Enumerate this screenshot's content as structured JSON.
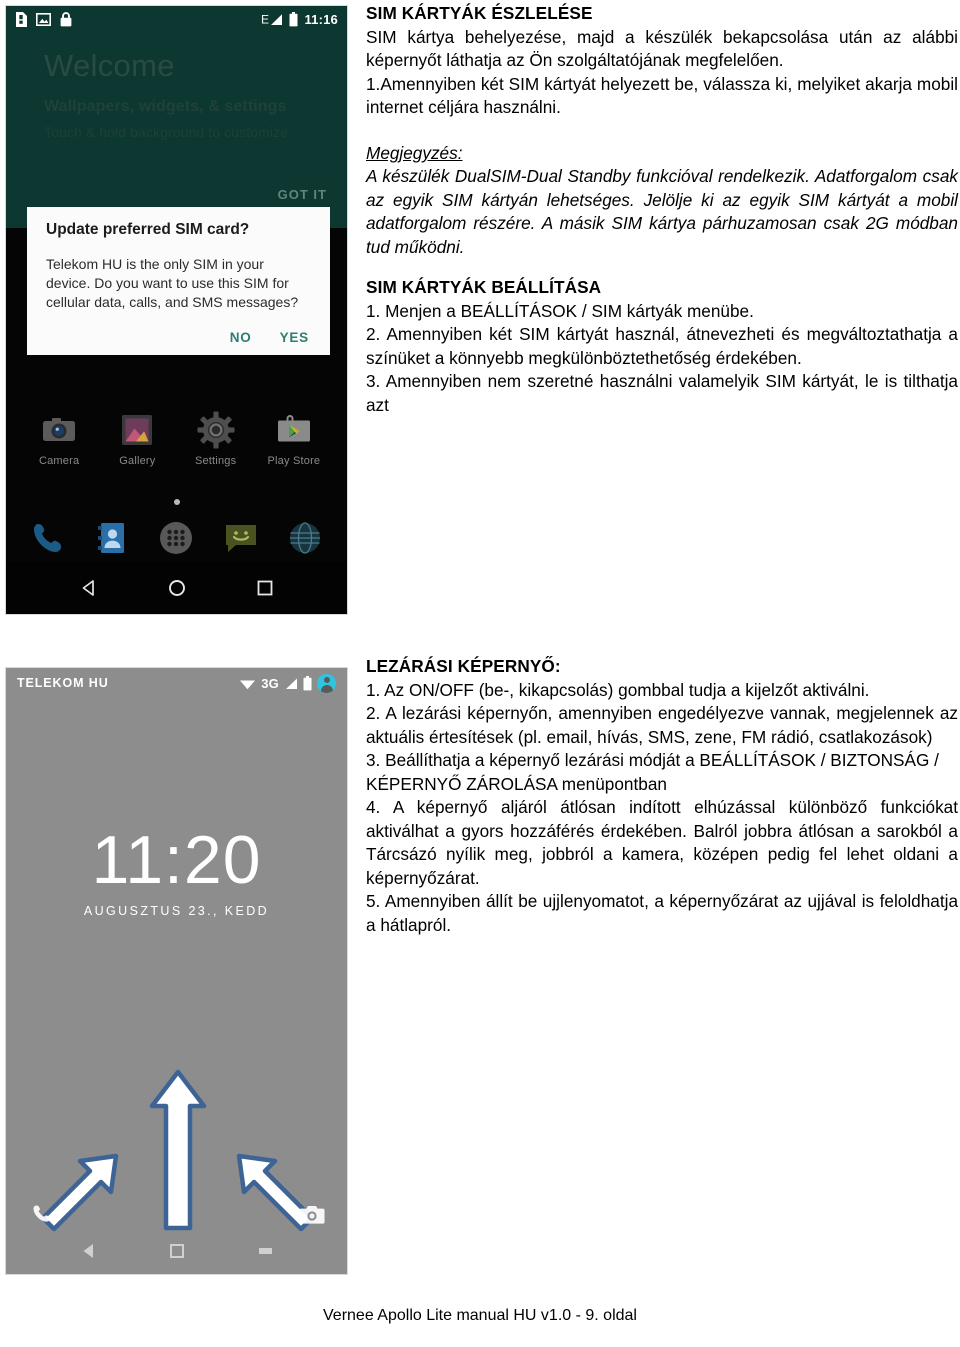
{
  "document": {
    "footer": "Vernee Apollo Lite manual HU v1.0 - 9. oldal"
  },
  "home_screenshot": {
    "status_bar": {
      "icons": [
        "sim-card-icon",
        "image-icon",
        "lock-icon"
      ],
      "network_type": "E",
      "time": "11:16"
    },
    "welcome": {
      "title": "Welcome",
      "subtitle": "Wallpapers, widgets, & settings",
      "hint": "Touch & hold background to customize",
      "got_it": "GOT IT"
    },
    "sim_dialog": {
      "title": "Update preferred SIM card?",
      "body": "Telekom HU is the only SIM in your device. Do you want to use this SIM for cellular data, calls, and SMS messages?",
      "no_label": "NO",
      "yes_label": "YES"
    },
    "apps": [
      {
        "label": "Camera",
        "icon": "camera-icon"
      },
      {
        "label": "Gallery",
        "icon": "gallery-icon"
      },
      {
        "label": "Settings",
        "icon": "gear-icon"
      },
      {
        "label": "Play Store",
        "icon": "play-store-icon"
      }
    ],
    "dock": [
      "phone-icon",
      "contacts-icon",
      "app-drawer-icon",
      "messaging-icon",
      "browser-icon"
    ],
    "nav": [
      "back-icon",
      "home-icon",
      "recents-icon"
    ]
  },
  "lock_screenshot": {
    "carrier": "TELEKOM HU",
    "network_type": "3G",
    "clock": "11:20",
    "date": "AUGUSZTUS 23., KEDD",
    "shortcuts": [
      "phone-icon",
      "unlock-icon",
      "camera-icon"
    ],
    "nav": [
      "back-icon",
      "home-icon",
      "recents-icon"
    ]
  },
  "content": {
    "section_detect": {
      "heading": "SIM KÁRTYÁK ÉSZLELÉSE",
      "intro": "SIM kártya behelyezése, majd a készülék bekapcsolása után az alábbi képernyőt láthatja az Ön szolgáltatójának megfelelően.",
      "step1": "1.Amennyiben két SIM kártyát helyezett be, válassza ki, melyiket akarja mobil internet céljára használni.",
      "note_label": "Megjegyzés:",
      "note_body": "A készülék DualSIM-Dual Standby funkcióval rendelkezik. Adatforgalom csak az egyik SIM kártyán lehetséges. Jelölje ki az egyik SIM kártyát a mobil adatforgalom részére. A másik SIM kártya párhuzamosan csak 2G módban tud működni."
    },
    "section_setup": {
      "heading": "SIM KÁRTYÁK BEÁLLÍTÁSA",
      "step1": "1. Menjen a BEÁLLÍTÁSOK / SIM kártyák menübe.",
      "step2": "2. Amennyiben két SIM kártyát használ, átnevezheti és megváltoztathatja a színüket a könnyebb megkülönböztethetőség érdekében.",
      "step3": "3. Amennyiben nem szeretné használni valamelyik SIM kártyát, le is tilthatja azt"
    },
    "section_lock": {
      "heading": "LEZÁRÁSI KÉPERNYŐ:",
      "step1": "1. Az ON/OFF (be-, kikapcsolás) gombbal tudja a kijelzőt aktiválni.",
      "step2": "2. A lezárási képernyőn, amennyiben engedélyezve vannak, megjelennek az aktuális értesítések (pl. email, hívás, SMS, zene, FM rádió, csatlakozások)",
      "step3": "3. Beállíthatja a képernyő lezárási módját a BEÁLLÍTÁSOK / BIZTONSÁG / KÉPERNYŐ ZÁROLÁSA menüpontban",
      "step4": "4. A képernyő aljáról átlósan indított elhúzással különböző funkciókat aktiválhat a gyors hozzáférés érdekében. Balról jobbra átlósan a sarokból a Tárcsázó nyílik meg, jobbról a kamera, középen pedig fel lehet oldani a képernyőzárat.",
      "step5": "5. Amennyiben állít be ujjlenyomatot, a képernyőzárat az ujjával is feloldhatja a hátlapról."
    }
  }
}
